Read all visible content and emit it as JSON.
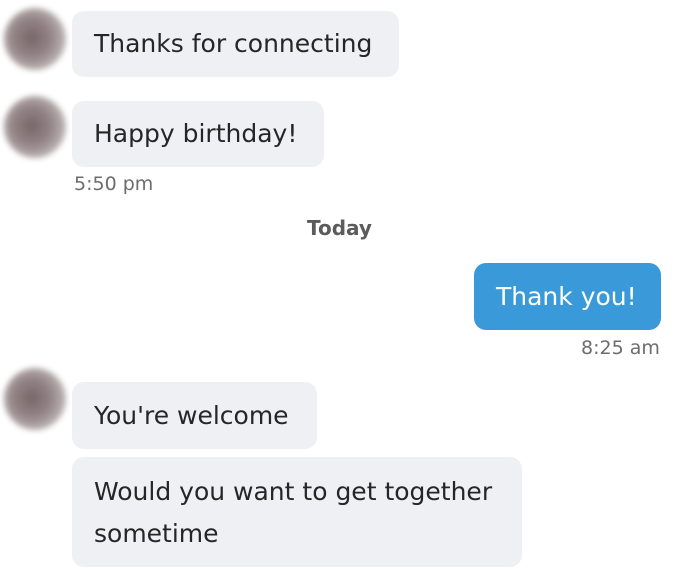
{
  "messages": [
    {
      "sender": "contact",
      "text": "Thanks for connecting"
    },
    {
      "sender": "contact",
      "text": "Happy birthday!"
    },
    {
      "timestamp": "5:50 pm"
    },
    {
      "day_divider": "Today"
    },
    {
      "sender": "me",
      "text": "Thank you!"
    },
    {
      "timestamp": "8:25 am"
    },
    {
      "sender": "contact",
      "text": "You're welcome"
    },
    {
      "sender": "contact",
      "text": "Would you want to get together sometime"
    }
  ],
  "colors": {
    "incoming_bubble": "#eef0f3",
    "outgoing_bubble": "#3a9ad9",
    "incoming_text": "#262626",
    "outgoing_text": "#ffffff",
    "timestamp_text": "#6d6d6d"
  }
}
